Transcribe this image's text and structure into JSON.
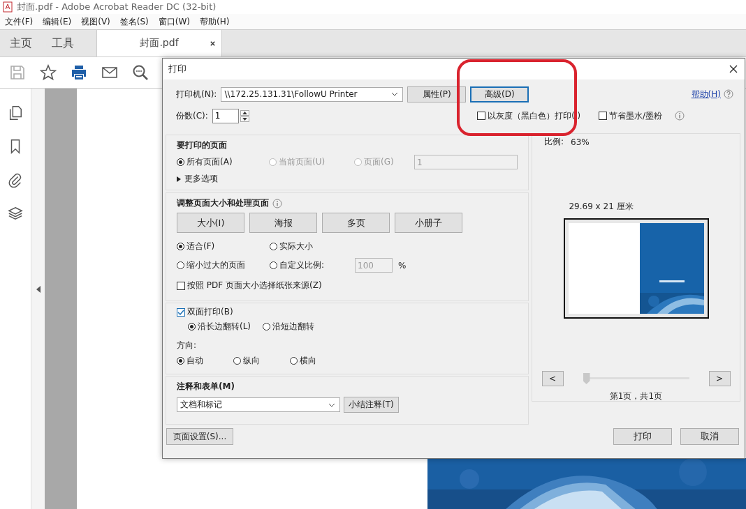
{
  "window": {
    "title": "封面.pdf - Adobe Acrobat Reader DC (32-bit)"
  },
  "menu": [
    "文件(F)",
    "编辑(E)",
    "视图(V)",
    "签名(S)",
    "窗口(W)",
    "帮助(H)"
  ],
  "tabs": [
    {
      "label": "主页",
      "selected": false,
      "kind": "nav"
    },
    {
      "label": "工具",
      "selected": false,
      "kind": "nav"
    },
    {
      "label": "封面.pdf",
      "selected": true,
      "kind": "document"
    }
  ],
  "dialog": {
    "title": "打印",
    "printer": {
      "label": "打印机(N):",
      "value": "\\\\172.25.131.31\\FollowU Printer"
    },
    "properties": "属性(P)",
    "advanced": "高级(D)",
    "help": "帮助(H)",
    "copies": {
      "label": "份数(C):",
      "value": "1"
    },
    "grayscale": {
      "label": "以灰度（黑白色）打印( )",
      "checked": false
    },
    "save_ink": {
      "label": "节省墨水/墨粉",
      "checked": false
    },
    "pages": {
      "title": "要打印的页面",
      "options": [
        {
          "label": "所有页面(A)",
          "selected": true,
          "disabled": false
        },
        {
          "label": "当前页面(U)",
          "selected": false,
          "disabled": true
        },
        {
          "label": "页面(G)",
          "selected": false,
          "disabled": true
        }
      ],
      "range": {
        "value": "1",
        "disabled": true
      },
      "more": "更多选项"
    },
    "sizing": {
      "title": "调整页面大小和处理页面",
      "modes": [
        "大小(I)",
        "海报",
        "多页",
        "小册子"
      ],
      "options": [
        {
          "label": "适合(F)",
          "selected": true
        },
        {
          "label": "实际大小",
          "selected": false
        },
        {
          "label": "缩小过大的页面",
          "selected": false
        },
        {
          "label": "自定义比例:",
          "selected": false
        }
      ],
      "custom_scale": {
        "value": "100",
        "unit": "%"
      },
      "paper_source": {
        "label": "按照 PDF 页面大小选择纸张来源(Z)",
        "checked": false
      }
    },
    "duplex": {
      "label": "双面打印(B)",
      "checked": true,
      "flip": [
        {
          "label": "沿长边翻转(L)",
          "selected": true
        },
        {
          "label": "沿短边翻转",
          "selected": false
        }
      ]
    },
    "orientation": {
      "label": "方向:",
      "options": [
        {
          "label": "自动",
          "selected": true
        },
        {
          "label": "纵向",
          "selected": false
        },
        {
          "label": "横向",
          "selected": false
        }
      ]
    },
    "comments": {
      "title": "注释和表单(M)",
      "value": "文档和标记",
      "summarize": "小结注释(T)"
    },
    "page_setup": "页面设置(S)...",
    "preview": {
      "scale_label": "比例:",
      "scale": "63%",
      "size": "29.69 x 21 厘米",
      "prev": "<",
      "next": ">",
      "slider": {
        "level": 0
      },
      "page_info": "第1页，共1页"
    },
    "actions": [
      "打印",
      "取消"
    ]
  }
}
